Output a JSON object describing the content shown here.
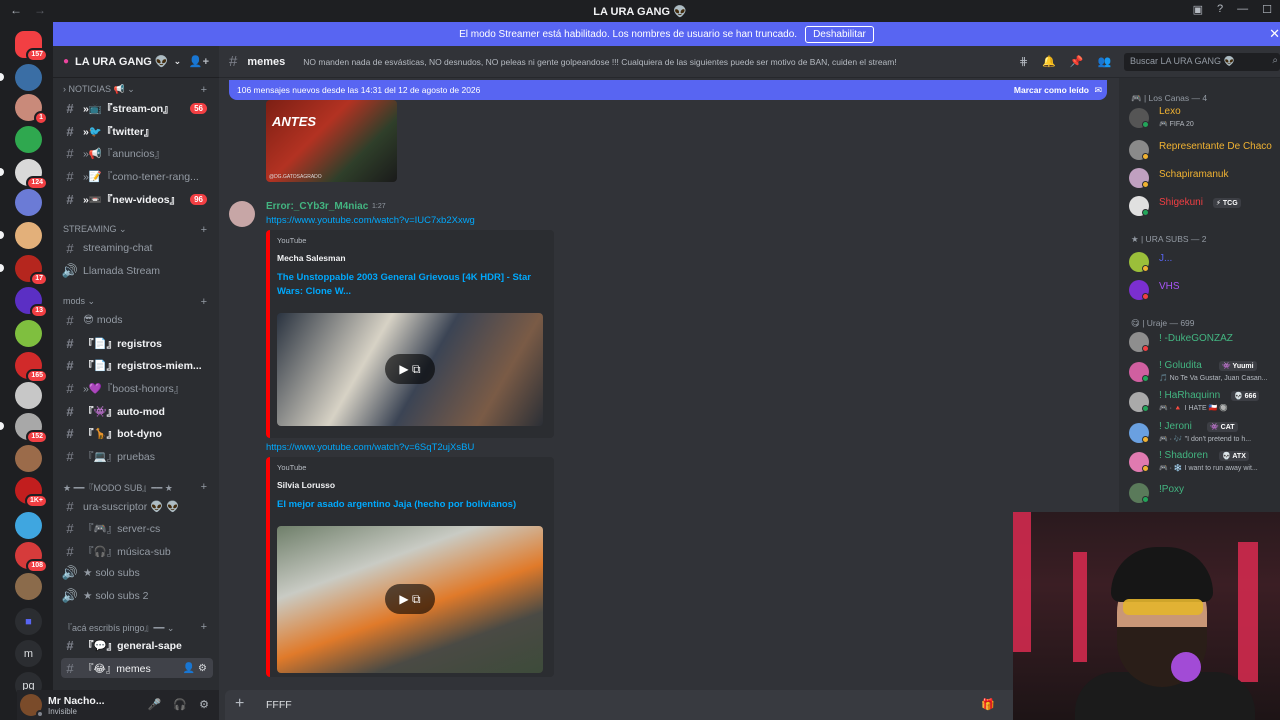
{
  "window": {
    "title": "LA URA GANG 👽",
    "back_icon": "arrow-left-icon",
    "forward_icon": "arrow-right-icon"
  },
  "streamer_banner": {
    "text": "El modo Streamer está habilitado. Los nombres de usuario se han truncado.",
    "button": "Deshabilitar",
    "close": "✕"
  },
  "servers": [
    {
      "label": "157",
      "color": "#f23f43"
    },
    {
      "label": "",
      "color": "#3a6ea5"
    },
    {
      "label": "1",
      "color": "#c98a7a"
    },
    {
      "label": "",
      "color": "#2fa84f"
    },
    {
      "label": "124",
      "color": "#d9d9d9"
    },
    {
      "label": "",
      "color": "#6b7bd6"
    },
    {
      "label": "",
      "color": "#e3b07a"
    },
    {
      "label": "17",
      "color": "#b5261e"
    },
    {
      "label": "13",
      "color": "#5b2fc4"
    },
    {
      "label": "",
      "color": "#7fbf3f"
    },
    {
      "label": "165",
      "color": "#d12a2a"
    },
    {
      "label": "",
      "color": "#c7c7c7"
    },
    {
      "label": "152",
      "color": "#a8a8a8"
    },
    {
      "label": "",
      "color": "#9b6b4a"
    },
    {
      "label": "1K+",
      "color": "#c21e1e"
    },
    {
      "label": "",
      "color": "#3fa6e0"
    },
    {
      "label": "108",
      "color": "#d63b3b"
    },
    {
      "label": "",
      "color": "#8b6b4b"
    }
  ],
  "servers_bottom": {
    "folder_icon": "folder-icon",
    "m": "m",
    "pg": "pg"
  },
  "guild": {
    "name": "LA URA GANG 👽",
    "invite_icon": "add-member-icon"
  },
  "categories": {
    "noticias": "NOTICIAS 📢",
    "streaming": "STREAMING",
    "mods": "mods",
    "modo_sub": "★ ━━『MODO SUB』━━ ★",
    "aca": "『acá escribís pingo』━━"
  },
  "channels": {
    "stream_on": "»📺『stream-on』",
    "twitter": "»🐦『twitter』",
    "anuncios": "»📢『anuncios』",
    "como_tener": "»📝『como-tener-rang...",
    "new_videos": "»📼『new-videos』",
    "streaming_chat": "streaming-chat",
    "llamada": "Llamada Stream",
    "mods_ch": "😎 mods",
    "registros": "『📄』registros",
    "registros_miem": "『📄』registros-miem...",
    "boost": "»💜『boost-honors』",
    "automod": "『👾』auto-mod",
    "botdyno": "『🦒』bot-dyno",
    "pruebas": "『💻』pruebas",
    "ura_sus": "ura-suscriptor 👽 👽",
    "server_cs": "『🎮』server-cs",
    "musica_sub": "『🎧』música-sub",
    "solo_subs": "★ solo subs",
    "solo_subs_2": "★ solo subs 2",
    "general_sape": "『💬』general-sape",
    "memes": "『😂』memes"
  },
  "badges": {
    "stream_on": "56",
    "new_videos": "96"
  },
  "user": {
    "name": "Mr Nacho...",
    "status": "Invisible"
  },
  "channel_header": {
    "name": "memes",
    "topic": "NO manden nada de esvásticas, NO desnudos, NO peleas ni gente golpeandose !!! Cualquiera de las siguientes puede ser motivo de BAN, cuiden el stream!"
  },
  "search": {
    "placeholder": "Buscar LA URA GANG 👽"
  },
  "new_messages": {
    "text": "106 mensajes nuevos desde las 14:31 del 12 de agosto de 2026",
    "action": "Marcar como leído"
  },
  "image_preview": {
    "caption": "ANTES",
    "watermark": "@DG.GATOSAGRADO"
  },
  "message": {
    "author": "Error:_CYb3r_M4niac",
    "time": "1:27",
    "link1": "https://www.youtube.com/watch?v=IUC7xb2Xxwg",
    "link2": "https://www.youtube.com/watch?v=6SqT2ujXsBU"
  },
  "embeds": [
    {
      "provider": "YouTube",
      "channel": "Mecha Salesman",
      "title": "The Unstoppable 2003 General Grievous [4K HDR] - Star Wars: Clone W..."
    },
    {
      "provider": "YouTube",
      "channel": "Silvia Lorusso",
      "title": "El mejor asado argentino Jaja (hecho por bolivianos)"
    }
  ],
  "composer": {
    "text": "FFFF"
  },
  "member_groups": [
    {
      "title": "🎮 | Los Canas — 4"
    },
    {
      "title": "★ | URA SUBS — 2"
    },
    {
      "title": "😋 | Uraje — 699"
    }
  ],
  "members": [
    {
      "name": "Lexo",
      "color": "#f0b232",
      "activity": "🎮 FIFA 20",
      "tag": ""
    },
    {
      "name": "Representante De Chaco",
      "color": "#f0b232",
      "activity": "",
      "tag": ""
    },
    {
      "name": "Schapiramanuk",
      "color": "#f0b232",
      "activity": "",
      "tag": ""
    },
    {
      "name": "Shigekuni",
      "color": "#f23f43",
      "activity": "",
      "tag": "⚡ TCG"
    },
    {
      "name": "J...",
      "color": "#5865f2",
      "activity": "",
      "tag": ""
    },
    {
      "name": "VHS",
      "color": "#a855f7",
      "activity": "",
      "tag": ""
    },
    {
      "name": "! -DukeGONZAZ",
      "color": "#43b581",
      "activity": "",
      "tag": ""
    },
    {
      "name": "! Goludita",
      "color": "#43b581",
      "activity": "🎵 No Te Va Gustar, Juan Casan...",
      "tag": "👾 Yuumi"
    },
    {
      "name": "! HaRhaquinn",
      "color": "#43b581",
      "activity": "🎮 · 🔺 I HATE 🇨🇱 🔘",
      "tag": "💀 666"
    },
    {
      "name": "! Jeroni",
      "color": "#43b581",
      "activity": "🎮 · 🎶 \"I don't pretend to h...",
      "tag": "👾 CAT"
    },
    {
      "name": "! Shadoren",
      "color": "#43b581",
      "activity": "🎮 · ❄️ I want to run away wit...",
      "tag": "💀 ATX"
    },
    {
      "name": "!Poxy",
      "color": "#43b581",
      "activity": "",
      "tag": ""
    }
  ]
}
